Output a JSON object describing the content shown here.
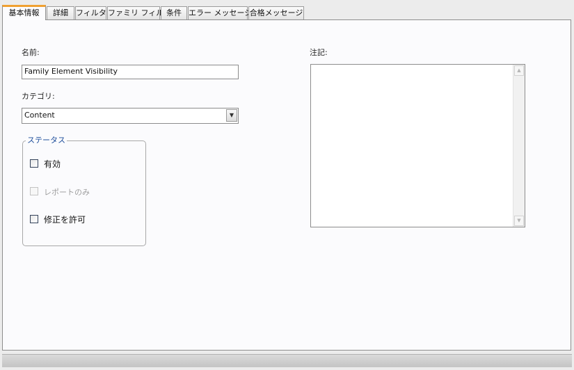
{
  "tabs": [
    {
      "label": "基本情報"
    },
    {
      "label": "詳細"
    },
    {
      "label": "フィルタ"
    },
    {
      "label": "ファミリ フィルタ"
    },
    {
      "label": "条件"
    },
    {
      "label": "エラー メッセージ"
    },
    {
      "label": "合格メッセージ"
    }
  ],
  "form": {
    "name_label": "名前:",
    "name_value": "Family Element Visibility",
    "category_label": "カテゴリ:",
    "category_value": "Content",
    "status_group": "ステータス",
    "checkboxes": [
      {
        "label": "有効",
        "checked": false,
        "enabled": true
      },
      {
        "label": "レポートのみ",
        "checked": false,
        "enabled": false
      },
      {
        "label": "修正を許可",
        "checked": false,
        "enabled": true
      }
    ],
    "notes_label": "注記:",
    "notes_value": ""
  }
}
